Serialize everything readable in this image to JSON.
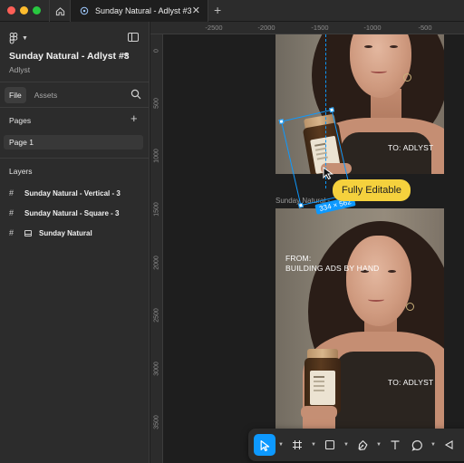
{
  "window": {
    "tab_title": "Sunday Natural - Adlyst #3",
    "tab_close": "✕",
    "new_tab": "+"
  },
  "sidebar": {
    "file_name": "Sunday Natural - Adlyst #3",
    "team_name": "Adlyst",
    "tabs": [
      {
        "label": "File",
        "active": true
      },
      {
        "label": "Assets",
        "active": false
      }
    ],
    "pages_title": "Pages",
    "add_page": "+",
    "pages": [
      {
        "label": "Page 1",
        "selected": true
      }
    ],
    "layers_title": "Layers",
    "layers": [
      {
        "label": "Sunday Natural - Vertical - 3",
        "icon": "frame-icon"
      },
      {
        "label": "Sunday Natural - Square - 3",
        "icon": "frame-icon"
      },
      {
        "label": "Sunday Natural",
        "icon": "image-frame-icon"
      }
    ]
  },
  "rulers": {
    "top": [
      "-2500",
      "-2000",
      "-1500",
      "-1000",
      "-500"
    ],
    "left": [
      "0",
      "500",
      "1000",
      "1500",
      "2000",
      "2500",
      "3000",
      "3500"
    ]
  },
  "canvas": {
    "frame_label": "Sunday Natural - ...",
    "top_image_text": "TO: ADLYST",
    "bottom_image_from": "FROM:",
    "bottom_image_headline": "BUILDING ADS BY HAND",
    "bottom_image_to": "TO: ADLYST",
    "selection_size": "334 × 562",
    "tooltip": "Fully Editable"
  },
  "toolbar": {
    "tools": [
      "move-tool",
      "frame-tool",
      "shape-tool",
      "pen-tool",
      "text-tool",
      "comment-tool",
      "actions-tool"
    ],
    "active_tool": "move-tool"
  },
  "colors": {
    "accent": "#0d99ff",
    "tooltip_bg": "#f5d13d",
    "panel_bg": "#2c2c2c",
    "canvas_bg": "#1e1e1e"
  }
}
